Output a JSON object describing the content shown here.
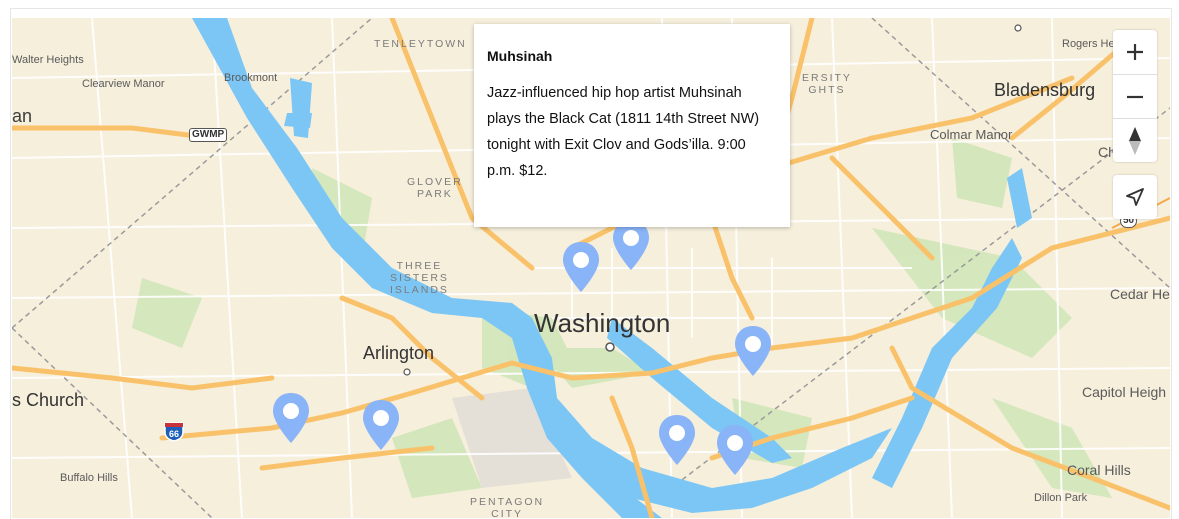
{
  "map": {
    "labels": {
      "tenleytown": "TENLEYTOWN",
      "walter_heights": "Walter Heights",
      "clearview_manor": "Clearview Manor",
      "brookmont": "Brookmont",
      "an": "an",
      "gwmp": "GWMP",
      "glover_park": "GLOVER\nPARK",
      "three_sisters": "THREE\nSISTERS\nISLANDS",
      "washington": "Washington",
      "arlington": "Arlington",
      "church": "s Church",
      "i66": "66",
      "buffalo_hills": "Buffalo Hills",
      "pentagon_city": "PENTAGON\nCITY",
      "ersity_ights": "ERSITY\nGHTS",
      "rogers_he": "Rogers He",
      "bladensburg": "Bladensburg",
      "colmar_manor": "Colmar Manor",
      "ch": "Ch",
      "route_50": "50",
      "cedar_he": "Cedar He",
      "capitol_heigh": "Capitol Heigh",
      "coral_hills": "Coral Hills",
      "dillon_park": "Dillon Park"
    },
    "markers": [
      {
        "id": "marker-1"
      },
      {
        "id": "marker-2"
      },
      {
        "id": "marker-3"
      },
      {
        "id": "marker-4"
      },
      {
        "id": "marker-5"
      },
      {
        "id": "marker-6"
      },
      {
        "id": "marker-7"
      }
    ],
    "marker_color": "#8ab4f8"
  },
  "popup": {
    "title": "Muhsinah",
    "body": "Jazz-influenced hip hop artist Muhsinah plays the Black Cat (1811 14th Street NW) tonight with Exit Clov and Gods’illa. 9:00 p.m. $12."
  },
  "controls": {
    "zoom_in": "+",
    "zoom_out": "−",
    "compass": "compass-icon",
    "locate": "locate-arrow-icon"
  },
  "colors": {
    "land": "#f6efdc",
    "water": "#7cc6f5",
    "park": "#cfe5b6",
    "major_road": "#f9c26a",
    "minor_road": "#ffffff"
  }
}
